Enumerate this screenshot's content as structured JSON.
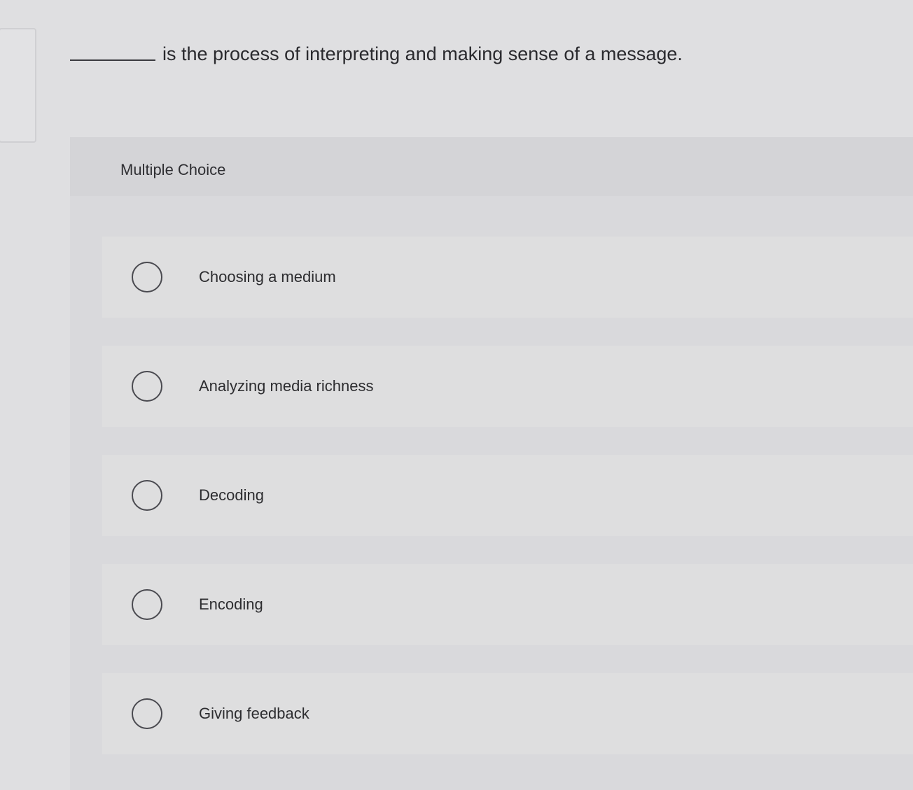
{
  "question": {
    "text": "is the process of interpreting and making sense of a message."
  },
  "answers": {
    "type_label": "Multiple Choice",
    "options": [
      {
        "label": "Choosing a medium"
      },
      {
        "label": "Analyzing media richness"
      },
      {
        "label": "Decoding"
      },
      {
        "label": "Encoding"
      },
      {
        "label": "Giving feedback"
      }
    ]
  }
}
